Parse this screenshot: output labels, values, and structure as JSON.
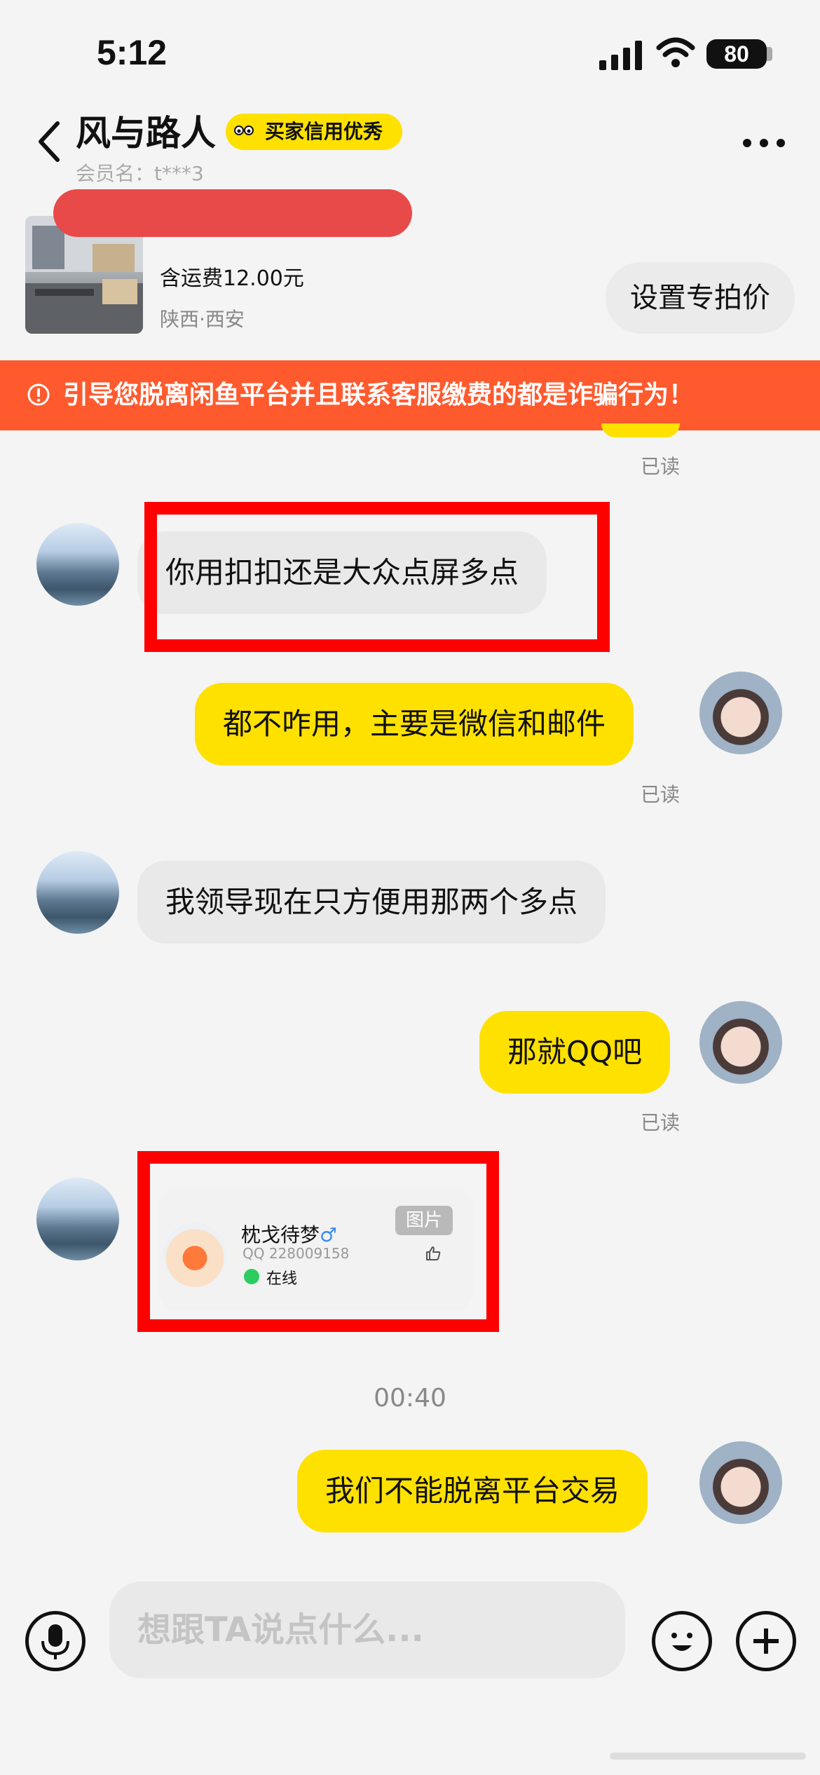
{
  "status_bar": {
    "time": "5:12",
    "battery": "80"
  },
  "header": {
    "title": "风与路人",
    "badge": "买家信用优秀",
    "member": "会员名：t***3"
  },
  "product": {
    "shipping": "含运费12.00元",
    "location": "陕西·西安",
    "set_price_label": "设置专拍价"
  },
  "warning": {
    "text": "引导您脱离闲鱼平台并且联系客服缴费的都是诈骗行为！"
  },
  "messages": [
    {
      "side": "left",
      "text": "你用扣扣还是大众点屏多点"
    },
    {
      "side": "right",
      "text": "都不咋用，主要是微信和邮件",
      "status": "已读"
    },
    {
      "side": "left",
      "text": "我领导现在只方便用那两个多点"
    },
    {
      "side": "right",
      "text": "那就QQ吧",
      "status": "已读"
    },
    {
      "side": "right",
      "text": "我们不能脱离平台交易"
    }
  ],
  "top_read": "已读",
  "qq_card": {
    "name": "枕戈待梦",
    "gender": "♂",
    "qq": "QQ 228009158",
    "status": "在线",
    "tag": "图片"
  },
  "timestamp": "00:40",
  "input": {
    "placeholder": "想跟TA说点什么..."
  }
}
